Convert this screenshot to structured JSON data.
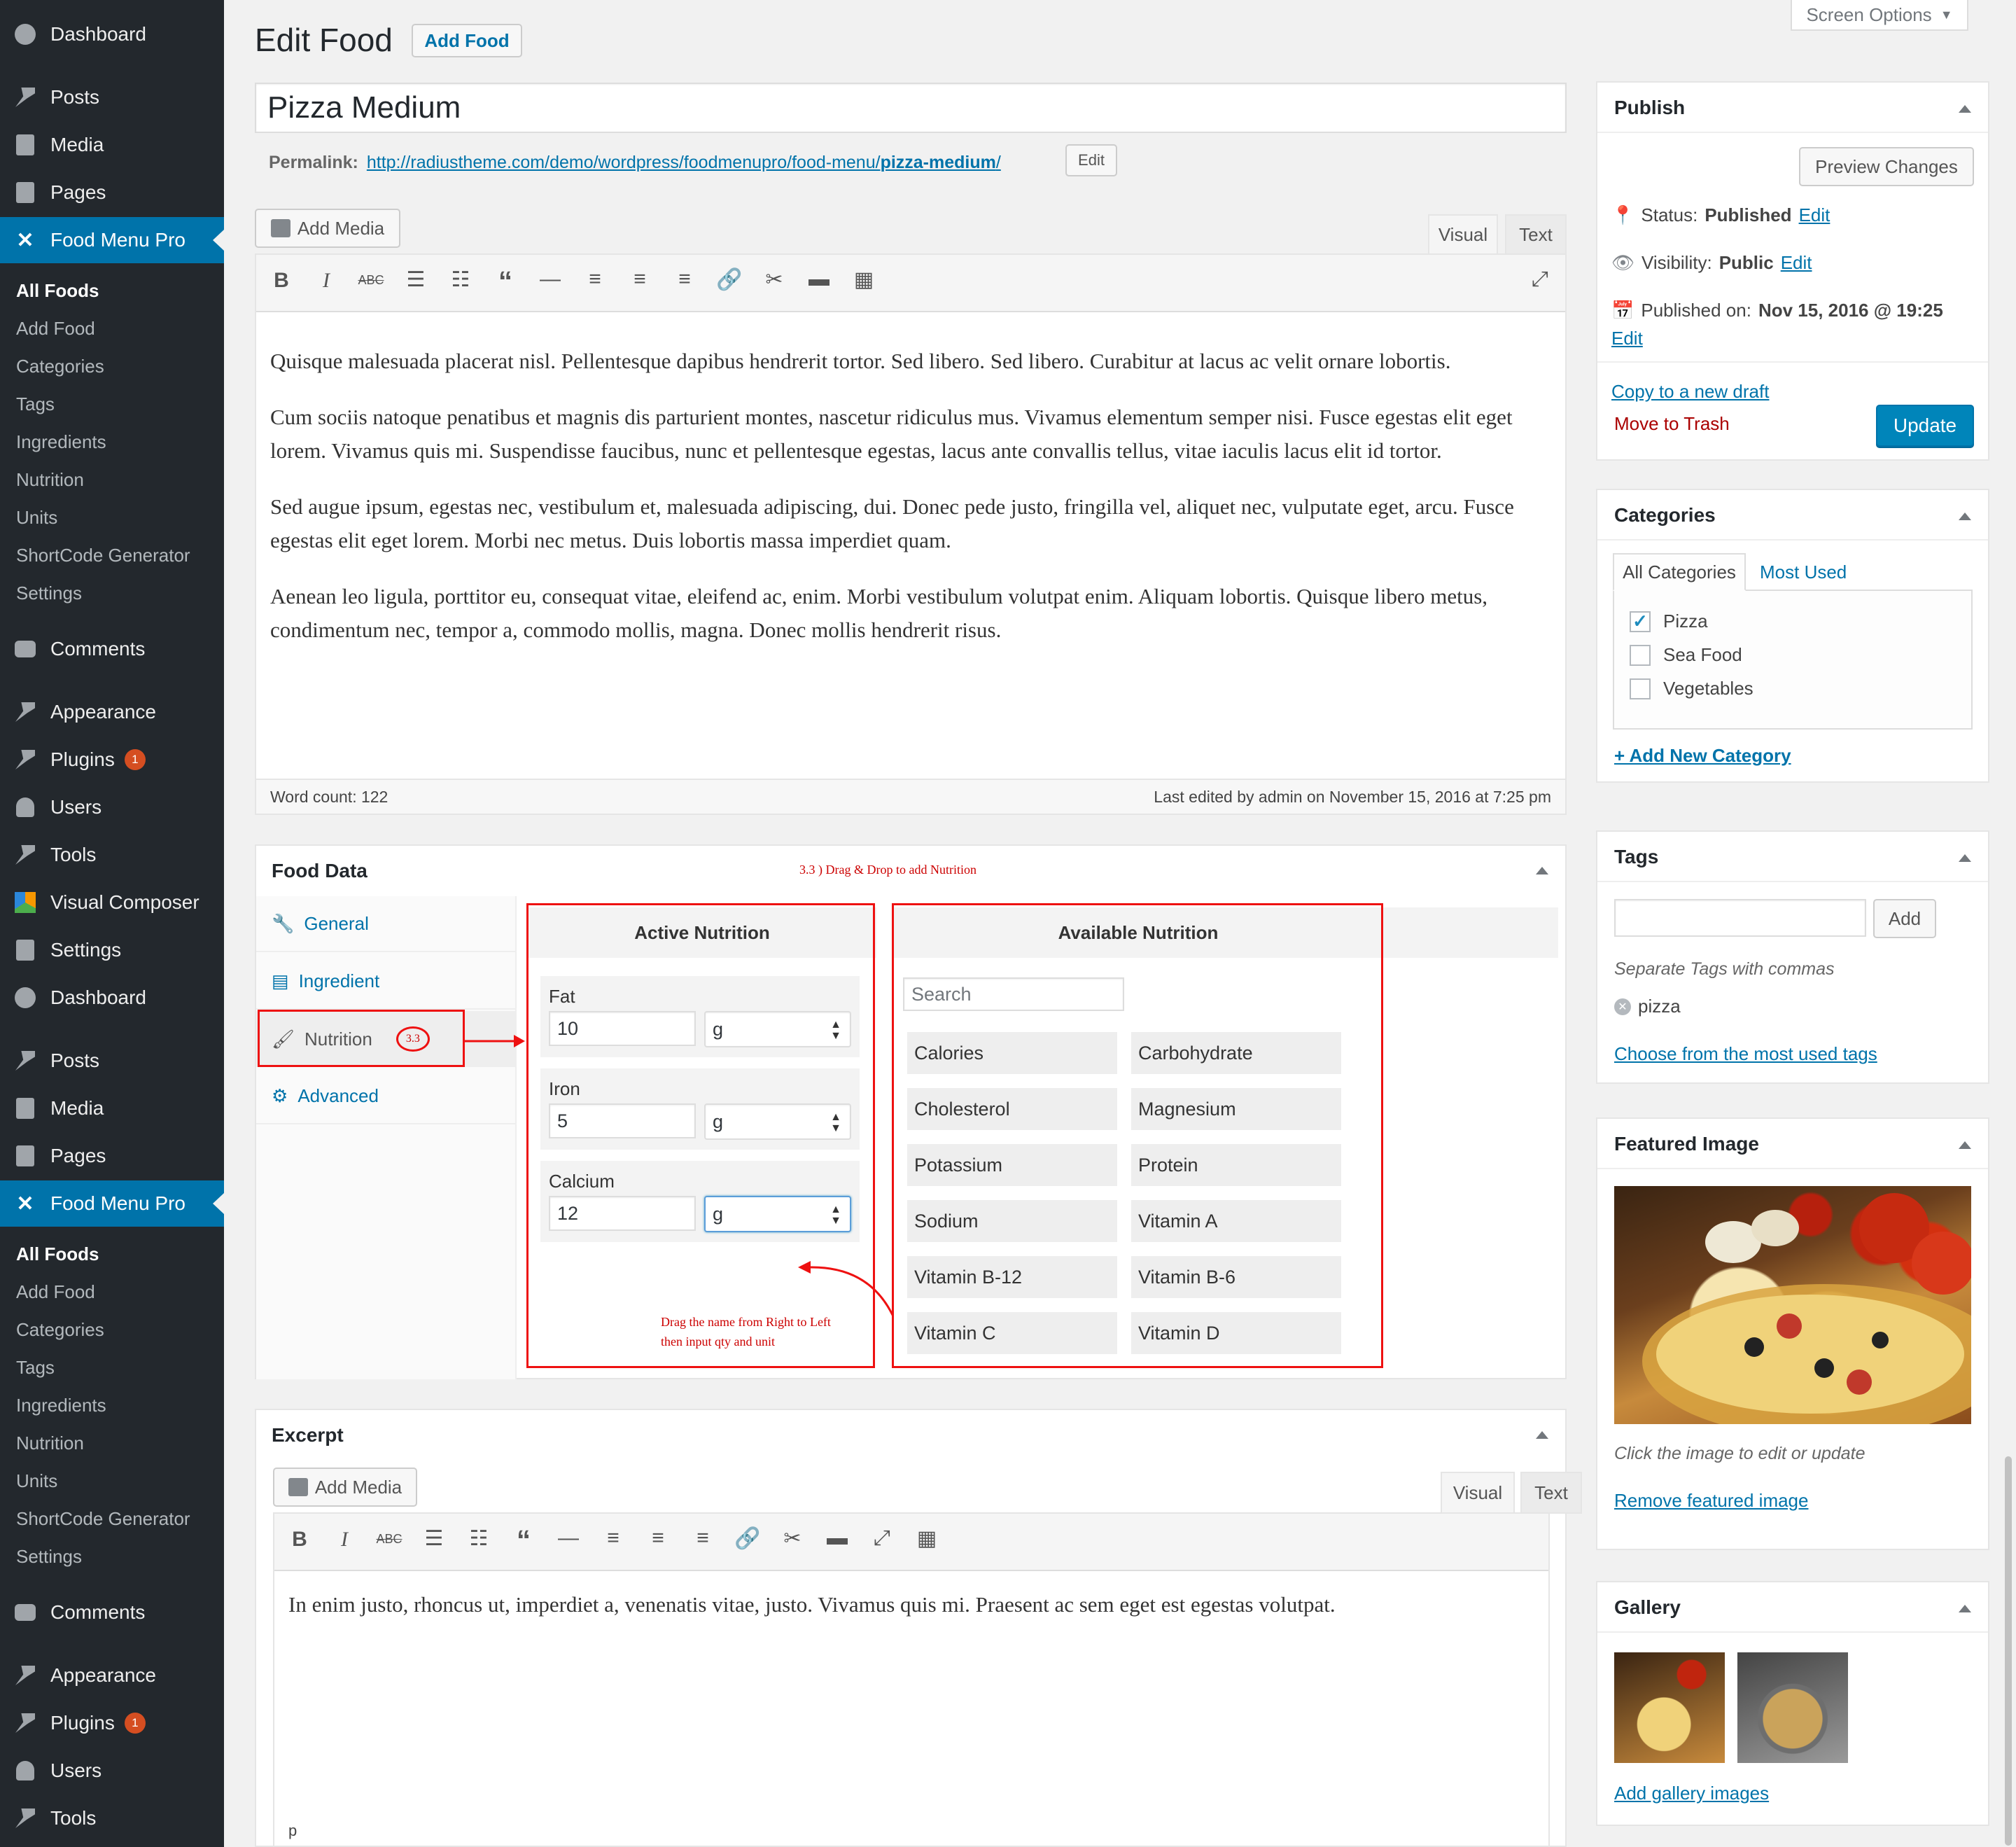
{
  "sidebar": {
    "group1": {
      "dashboard": "Dashboard",
      "posts": "Posts",
      "media": "Media",
      "pages": "Pages",
      "food_menu_pro": "Food Menu Pro",
      "submenu": [
        "All Foods",
        "Add Food",
        "Categories",
        "Tags",
        "Ingredients",
        "Nutrition",
        "Units",
        "ShortCode Generator",
        "Settings"
      ],
      "comments": "Comments",
      "appearance": "Appearance",
      "plugins": "Plugins",
      "plugins_badge": "1",
      "users": "Users",
      "tools": "Tools",
      "visual_composer": "Visual Composer",
      "settings": "Settings"
    },
    "group2": {
      "dashboard": "Dashboard",
      "posts": "Posts",
      "media": "Media",
      "pages": "Pages",
      "food_menu_pro": "Food Menu Pro",
      "submenu": [
        "All Foods",
        "Add Food",
        "Categories",
        "Tags",
        "Ingredients",
        "Nutrition",
        "Units",
        "ShortCode Generator",
        "Settings"
      ],
      "comments": "Comments",
      "appearance": "Appearance",
      "plugins": "Plugins",
      "plugins_badge": "1",
      "users": "Users",
      "tools": "Tools"
    }
  },
  "header": {
    "title": "Edit Food",
    "add_button": "Add Food",
    "screen_options": "Screen Options"
  },
  "post": {
    "title": "Pizza Medium",
    "permalink_label": "Permalink:",
    "permalink_base": "http://radiustheme.com/demo/wordpress/foodmenupro/food-menu/",
    "permalink_slug": "pizza-medium",
    "permalink_trailing": "/",
    "permalink_edit": "Edit"
  },
  "editor": {
    "add_media": "Add Media",
    "tab_visual": "Visual",
    "tab_text": "Text",
    "paragraphs": [
      "Quisque malesuada placerat nisl. Pellentesque dapibus hendrerit tortor. Sed libero. Sed libero. Curabitur at lacus ac velit ornare lobortis.",
      "Cum sociis natoque penatibus et magnis dis parturient montes, nascetur ridiculus mus. Vivamus elementum semper nisi. Fusce egestas elit eget lorem. Vivamus quis mi. Suspendisse faucibus, nunc et pellentesque egestas, lacus ante convallis tellus, vitae iaculis lacus elit id tortor.",
      "Sed augue ipsum, egestas nec, vestibulum et, malesuada adipiscing, dui. Donec pede justo, fringilla vel, aliquet nec, vulputate eget, arcu. Fusce egestas elit eget lorem. Morbi nec metus. Duis lobortis massa imperdiet quam.",
      "Aenean leo ligula, porttitor eu, consequat vitae, eleifend ac, enim. Morbi vestibulum volutpat enim. Aliquam lobortis. Quisque libero metus, condimentum nec, tempor a, commodo mollis, magna. Donec mollis hendrerit risus."
    ],
    "word_count": "Word count: 122",
    "last_edited": "Last edited by admin on November 15, 2016 at 7:25 pm"
  },
  "food_data": {
    "title": "Food Data",
    "annotation_top": "3.3 ) Drag & Drop to add Nutrition",
    "tabs": [
      "General",
      "Ingredient",
      "Nutrition",
      "Advanced"
    ],
    "nutrition_badge": "3.3",
    "active_title": "Active Nutrition",
    "available_title": "Available Nutrition",
    "active": [
      {
        "name": "Fat",
        "qty": "10",
        "unit": "g"
      },
      {
        "name": "Iron",
        "qty": "5",
        "unit": "g"
      },
      {
        "name": "Calcium",
        "qty": "12",
        "unit": "g"
      }
    ],
    "search_placeholder": "Search",
    "available": [
      "Calories",
      "Carbohydrate",
      "Cholesterol",
      "Magnesium",
      "Potassium",
      "Protein",
      "Sodium",
      "Vitamin A",
      "Vitamin B-12",
      "Vitamin B-6",
      "Vitamin C",
      "Vitamin D"
    ],
    "annotation_drag_1": "Drag the name from Right to Left",
    "annotation_drag_2": "then input qty and unit"
  },
  "excerpt": {
    "title": "Excerpt",
    "add_media": "Add Media",
    "tab_visual": "Visual",
    "tab_text": "Text",
    "content": "In enim justo, rhoncus ut, imperdiet a, venenatis vitae, justo. Vivamus quis mi. Praesent ac sem eget est egestas volutpat.",
    "path": "p"
  },
  "publish": {
    "title": "Publish",
    "preview": "Preview Changes",
    "status_label": "Status:",
    "status_value": "Published",
    "visibility_label": "Visibility:",
    "visibility_value": "Public",
    "published_label": "Published on:",
    "published_value": "Nov 15, 2016 @ 19:25",
    "edit": "Edit",
    "copy_draft": "Copy to a new draft",
    "trash": "Move to Trash",
    "update": "Update"
  },
  "categories": {
    "title": "Categories",
    "tab_all": "All Categories",
    "tab_most": "Most Used",
    "items": [
      {
        "label": "Pizza",
        "checked": true
      },
      {
        "label": "Sea Food",
        "checked": false
      },
      {
        "label": "Vegetables",
        "checked": false
      }
    ],
    "add_new": "+ Add New Category"
  },
  "tags": {
    "title": "Tags",
    "add": "Add",
    "hint": "Separate Tags with commas",
    "items": [
      "pizza"
    ],
    "choose": "Choose from the most used tags"
  },
  "featured": {
    "title": "Featured Image",
    "hint": "Click the image to edit or update",
    "remove": "Remove featured image"
  },
  "gallery": {
    "title": "Gallery",
    "add": "Add gallery images"
  },
  "colors": {
    "admin_bg": "#23282d",
    "accent": "#0073aa",
    "primary_button": "#0085ba",
    "annotation_red": "#e11111",
    "trash_red": "#a00"
  }
}
